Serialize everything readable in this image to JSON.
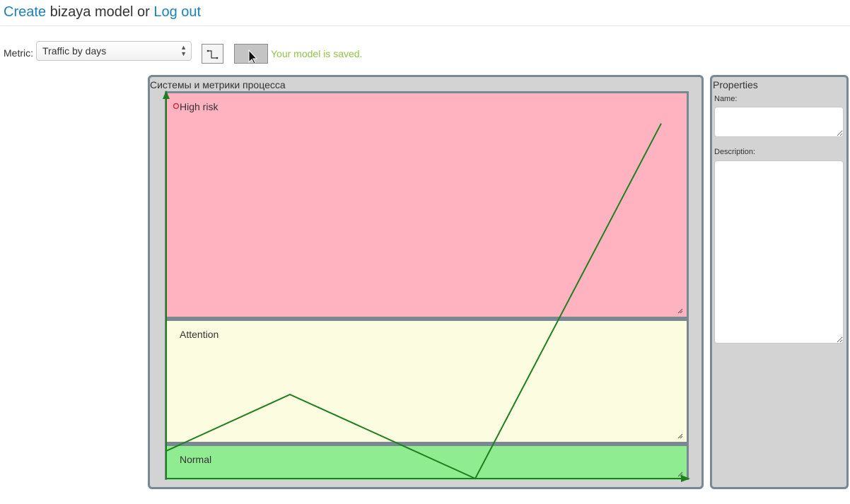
{
  "header": {
    "create_link": "Create",
    "middle_text": " bizaya model or ",
    "logout_link": "Log out"
  },
  "toolbar": {
    "metric_label": "Metric:",
    "metric_selected": "Traffic by days",
    "saved_message": "Your model is saved."
  },
  "model": {
    "title": "Системы и метрики процесса",
    "zones": {
      "high": "High risk",
      "attention": "Attention",
      "normal": "Normal"
    }
  },
  "properties": {
    "title": "Properties",
    "name_label": "Name:",
    "name_value": "",
    "description_label": "Description:",
    "description_value": ""
  },
  "colors": {
    "link": "#1f80c0",
    "saved": "#8fc44a",
    "high_risk": "#ffb3c0",
    "attention": "#fcfce0",
    "normal": "#90ec90",
    "line": "#1f7f1f",
    "panel": "#d3d3d3",
    "panel_border": "#7a8893"
  },
  "chart_data": {
    "type": "line",
    "series": [
      {
        "values": [
          0.19,
          0.58,
          0.0,
          2.45
        ]
      }
    ]
  }
}
